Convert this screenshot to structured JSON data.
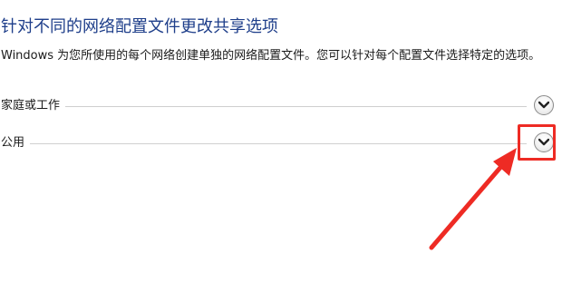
{
  "page": {
    "title": "针对不同的网络配置文件更改共享选项",
    "description": "Windows 为您所使用的每个网络创建单独的网络配置文件。您可以针对每个配置文件选择特定的选项。"
  },
  "profiles": [
    {
      "label": "家庭或工作",
      "icon": "chevron-down-icon"
    },
    {
      "label": "公用",
      "icon": "chevron-down-icon"
    }
  ],
  "annotation": {
    "color": "#ee2b24"
  },
  "colors": {
    "heading": "#1e3e8a",
    "divider": "#cfcfcf"
  }
}
